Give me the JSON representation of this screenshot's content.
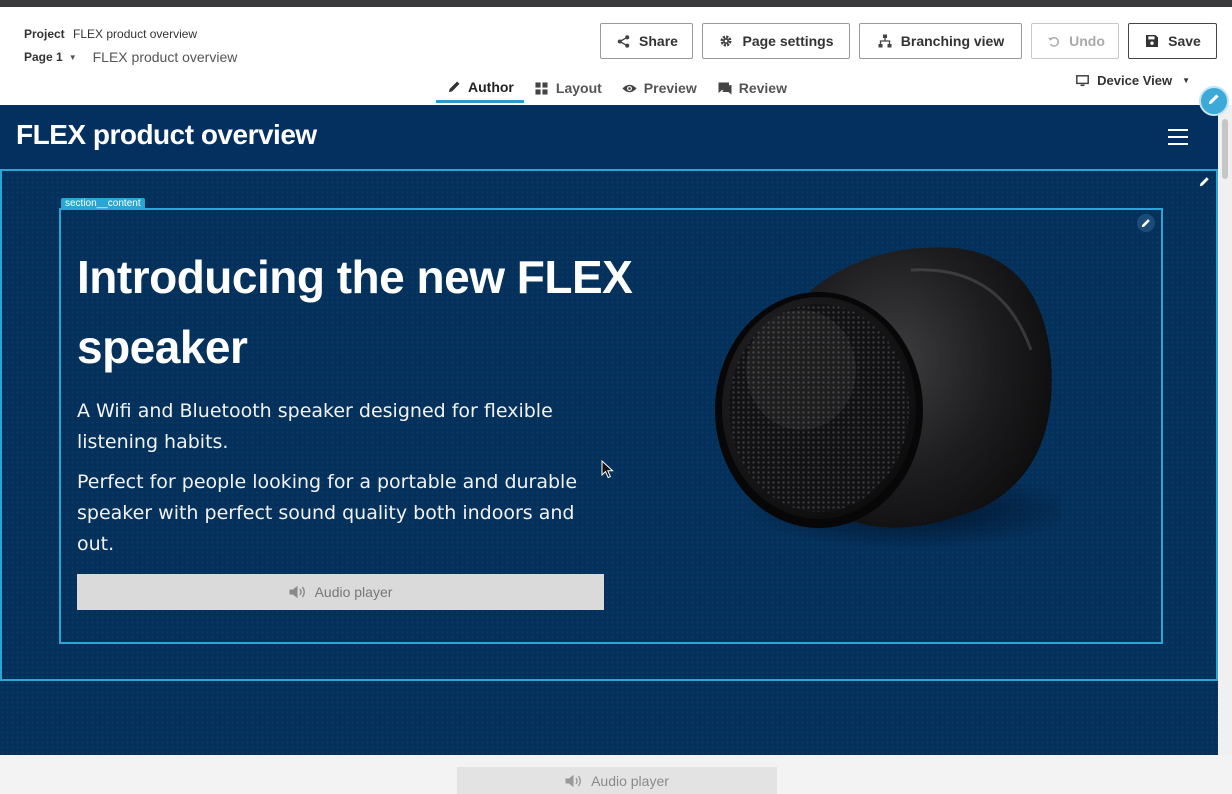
{
  "header": {
    "project_label": "Project",
    "project_name": "FLEX product overview",
    "page_selector": "Page 1",
    "page_name": "FLEX product overview",
    "buttons": {
      "share": "Share",
      "page_settings": "Page settings",
      "branching_view": "Branching view",
      "undo": "Undo",
      "save": "Save"
    },
    "tabs": [
      {
        "label": "Author",
        "icon": "pencil-icon",
        "active": true
      },
      {
        "label": "Layout",
        "icon": "grid-icon",
        "active": false
      },
      {
        "label": "Preview",
        "icon": "eye-icon",
        "active": false
      },
      {
        "label": "Review",
        "icon": "comment-icon",
        "active": false
      }
    ],
    "device_view": "Device View"
  },
  "canvas": {
    "site_title": "FLEX product overview",
    "section_tag": "section__content",
    "hero_title": "Introducing the new FLEX speaker",
    "paragraph_1": "A Wifi and Bluetooth speaker designed for flexible listening habits.",
    "paragraph_2": "Perfect for people looking for a portable and durable speaker with perfect sound quality both indoors and out.",
    "audio_player": "Audio player"
  },
  "footer": {
    "audio_player": "Audio player"
  },
  "colors": {
    "canvas_bg": "#04315c",
    "accent": "#2aa6d4",
    "active_tab": "#2b9ac8"
  }
}
